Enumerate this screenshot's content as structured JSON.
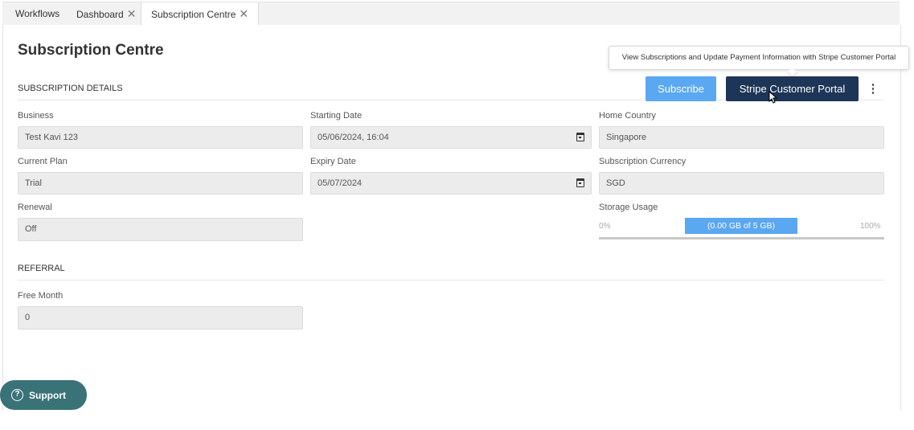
{
  "tabs": [
    {
      "label": "Workflows",
      "closable": false
    },
    {
      "label": "Dashboard",
      "closable": true
    },
    {
      "label": "Subscription Centre",
      "closable": true,
      "active": true
    }
  ],
  "page": {
    "title": "Subscription Centre"
  },
  "tooltip": {
    "text": "View Subscriptions and Update Payment Information with Stripe Customer Portal"
  },
  "actions": {
    "subscribe_label": "Subscribe",
    "portal_label": "Stripe Customer Portal",
    "more_icon": "⋮"
  },
  "subscription_details": {
    "title": "SUBSCRIPTION DETAILS",
    "business": {
      "label": "Business",
      "value": "Test Kavi 123"
    },
    "starting_date": {
      "label": "Starting Date",
      "value": "05/06/2024, 16:04"
    },
    "home_country": {
      "label": "Home Country",
      "value": "Singapore"
    },
    "current_plan": {
      "label": "Current Plan",
      "value": "Trial"
    },
    "expiry_date": {
      "label": "Expiry Date",
      "value": "05/07/2024"
    },
    "subscription_currency": {
      "label": "Subscription Currency",
      "value": "SGD"
    },
    "renewal": {
      "label": "Renewal",
      "value": "Off"
    },
    "storage": {
      "label": "Storage Usage",
      "min_label": "0%",
      "max_label": "100%",
      "bar_text": "(0.00 GB of 5 GB)",
      "used_fraction": 0.0
    }
  },
  "referral": {
    "title": "REFERRAL",
    "free_month": {
      "label": "Free Month",
      "value": "0"
    }
  },
  "support": {
    "label": "Support"
  },
  "colors": {
    "primary": "#5aa7f2",
    "portal": "#1d3557",
    "support": "#3a7377"
  }
}
